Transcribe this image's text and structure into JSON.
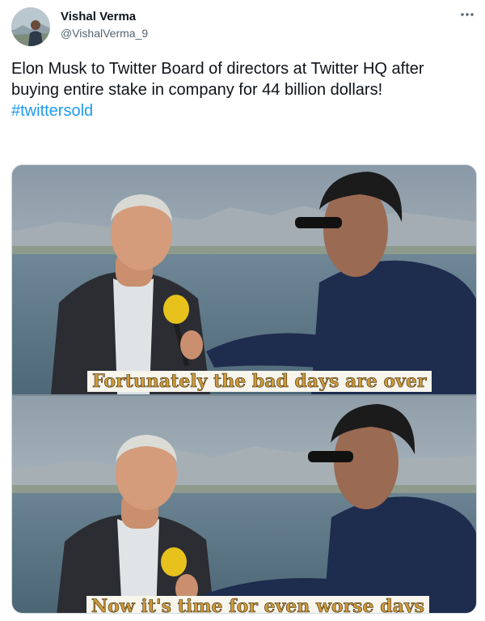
{
  "tweet": {
    "author": {
      "display_name": "Vishal Verma",
      "handle": "@VishalVerma_9",
      "avatar_icon": "profile-photo"
    },
    "more_icon": "ellipsis-icon",
    "text": "Elon Musk to Twitter Board of directors at Twitter HQ after buying entire stake in company for 44 billion dollars!",
    "hashtag": "#twittersold",
    "link_color": "#1d9bf0"
  },
  "media": {
    "type": "meme-image",
    "panels": [
      {
        "caption": "Fortunately the bad days are over"
      },
      {
        "caption": "Now it's time for even worse days"
      }
    ]
  }
}
